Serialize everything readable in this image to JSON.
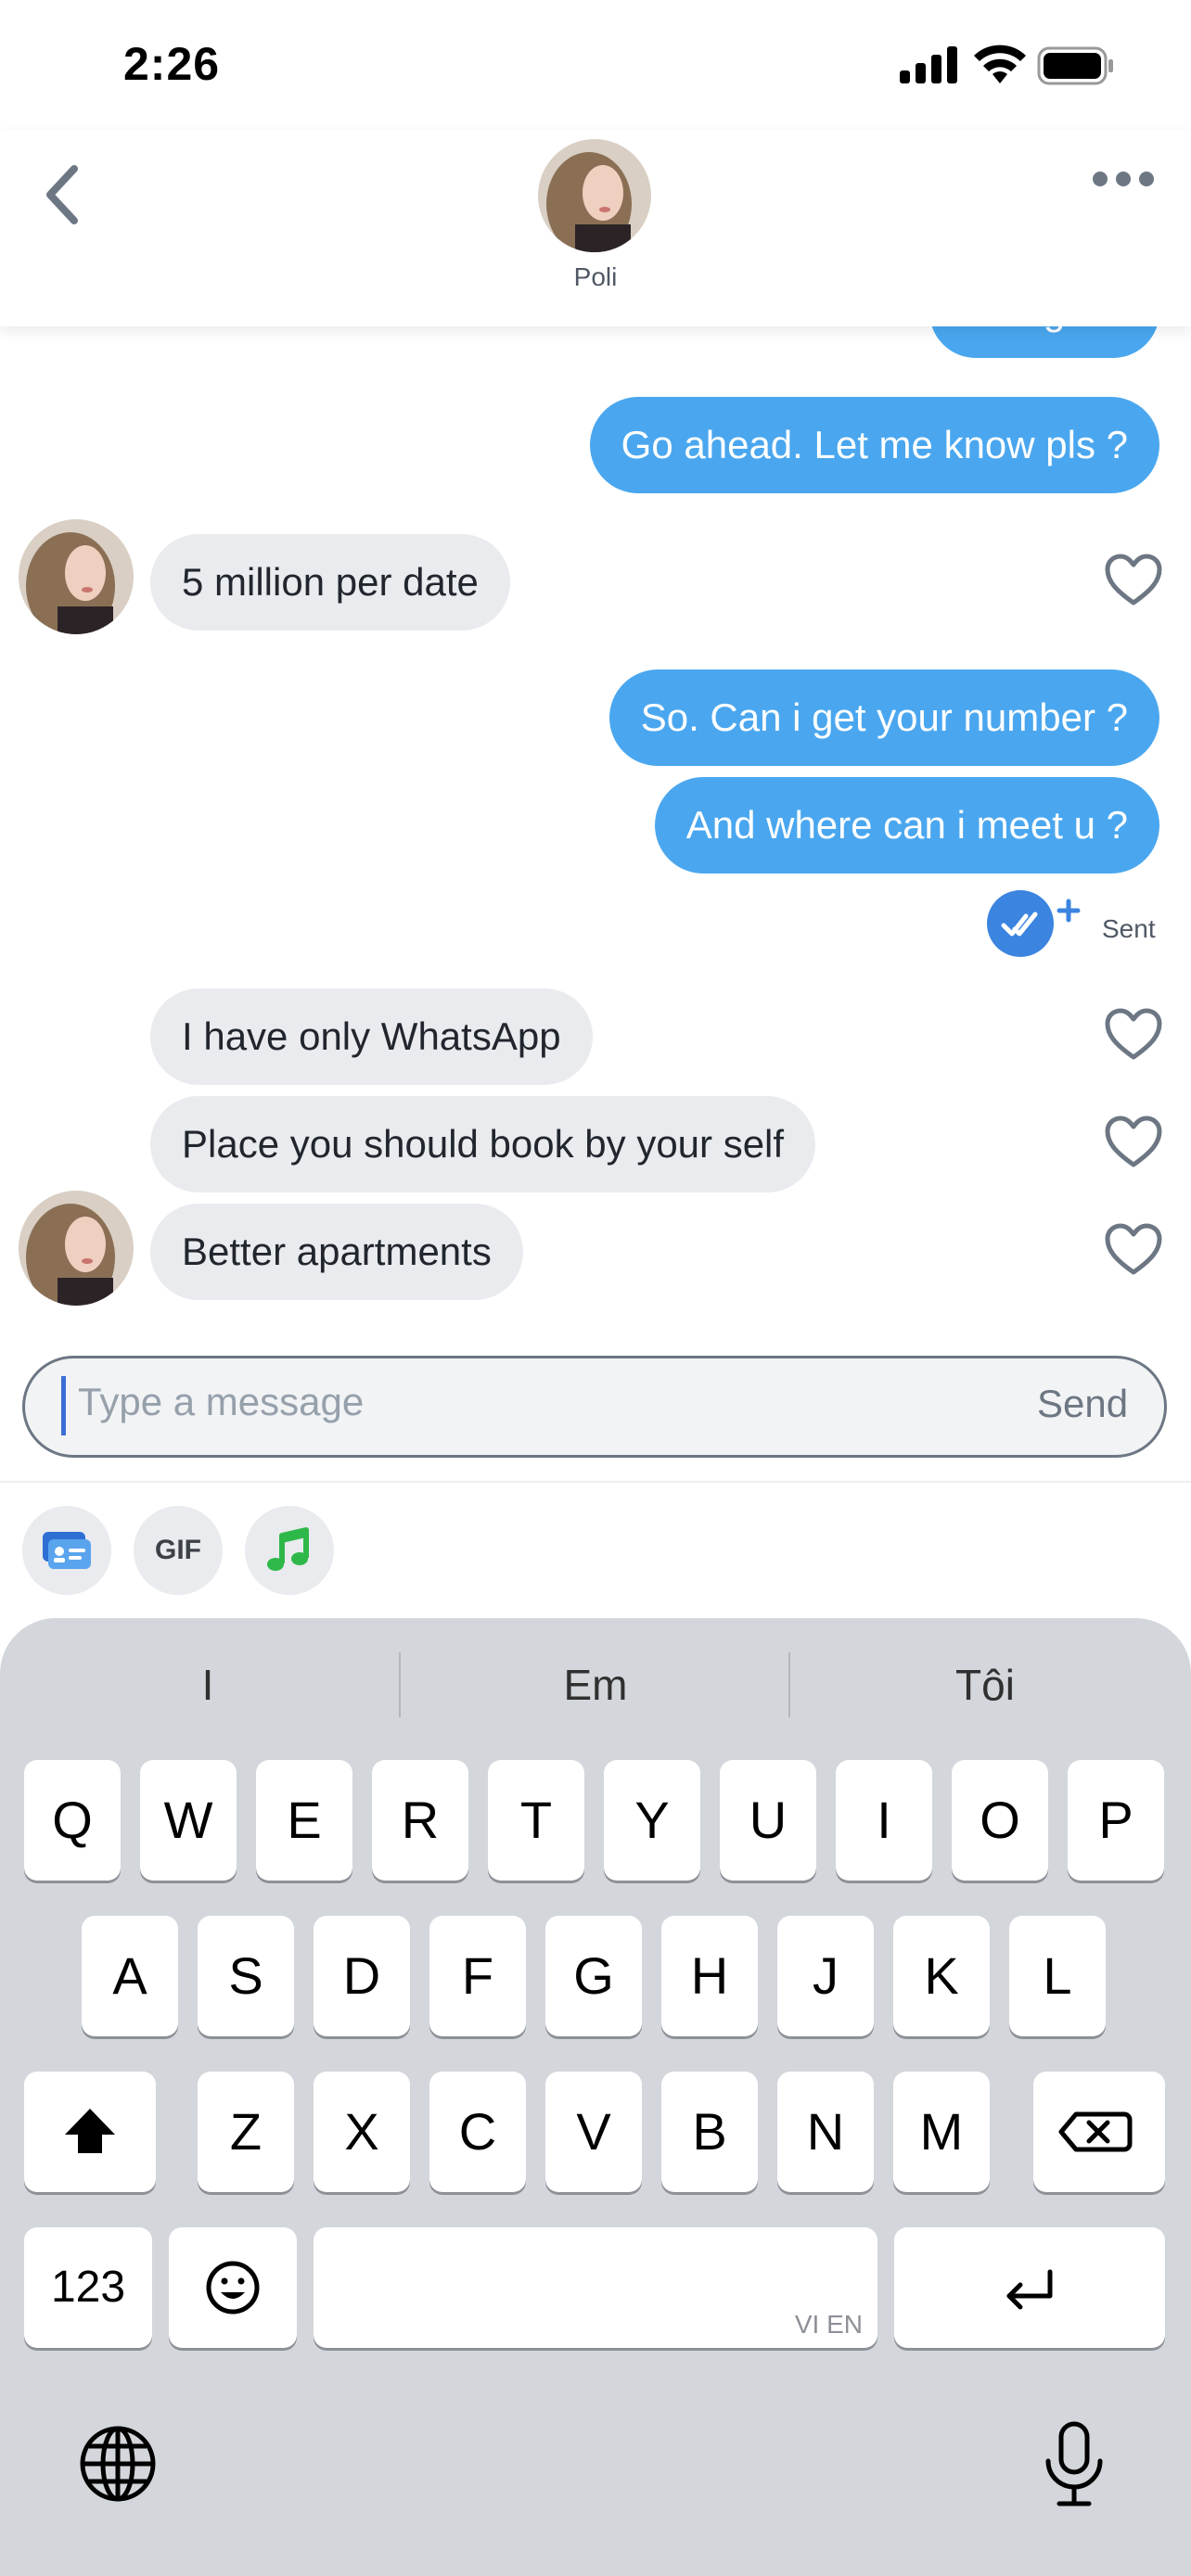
{
  "status_bar": {
    "time": "2:26"
  },
  "header": {
    "name": "Poli"
  },
  "messages": [
    {
      "dir": "out",
      "text": "Oh i got it"
    },
    {
      "dir": "out",
      "text": "Go ahead. Let me know pls ?"
    },
    {
      "dir": "in",
      "text": "5 million per date"
    },
    {
      "dir": "out",
      "text": "So. Can i get your number ?"
    },
    {
      "dir": "out",
      "text": "And where can i meet u ?"
    },
    {
      "dir": "in",
      "text": "I have only WhatsApp"
    },
    {
      "dir": "in",
      "text": "Place you should book by your self"
    },
    {
      "dir": "in",
      "text": "Better apartments"
    }
  ],
  "read_status": {
    "label": "Sent"
  },
  "composer": {
    "placeholder": "Type a message",
    "send_label": "Send"
  },
  "tools": {
    "gif_label": "GIF"
  },
  "keyboard": {
    "suggestions": [
      "I",
      "Em",
      "Tôi"
    ],
    "row1": [
      "Q",
      "W",
      "E",
      "R",
      "T",
      "Y",
      "U",
      "I",
      "O",
      "P"
    ],
    "row2": [
      "A",
      "S",
      "D",
      "F",
      "G",
      "H",
      "J",
      "K",
      "L"
    ],
    "row3": [
      "Z",
      "X",
      "C",
      "V",
      "B",
      "N",
      "M"
    ],
    "numbers_label": "123",
    "space_hint": "VI EN"
  },
  "colors": {
    "outgoing": "#4aa7ef",
    "incoming": "#e9ebee",
    "accent": "#3b84e0"
  }
}
